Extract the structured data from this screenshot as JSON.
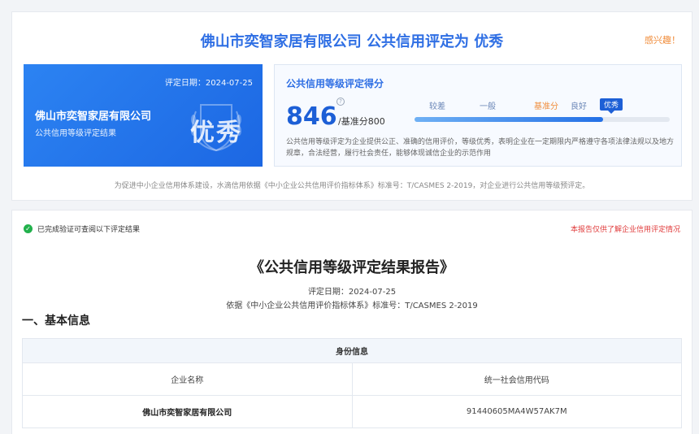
{
  "header": {
    "title": "佛山市奕智家居有限公司 公共信用评定为 优秀",
    "interest_link": "感兴趣！"
  },
  "summary_card": {
    "date": "评定日期：2024-07-25",
    "company": "佛山市奕智家居有限公司",
    "subtitle": "公共信用等级评定结果",
    "badge_text": "优秀",
    "badge_icon": "laurel-shield-icon"
  },
  "score_panel": {
    "title": "公共信用等级评定得分",
    "score": "846",
    "info_icon": "?",
    "baseline": "/基准分800",
    "levels": [
      {
        "label": "较差"
      },
      {
        "label": "一般"
      },
      {
        "label": "基准分"
      },
      {
        "label": "良好"
      },
      {
        "label": "优秀"
      }
    ],
    "progress_fraction": 0.74,
    "description": "公共信用等级评定为企业提供公正、准确的信用评价，等级优秀，表明企业在一定期限内严格遵守各项法律法规以及地方规章，合法经营，履行社会责任，能够体现诚信企业的示范作用"
  },
  "footnote": "为促进中小企业信用体系建设，水滴信用依据《中小企业公共信用评价指标体系》标准号：T/CASMES 2-2019，对企业进行公共信用等级预评定。",
  "report": {
    "verify_text": "已完成验证可查阅以下评定结果",
    "disclaimer": "本报告仅供了解企业信用评定情况",
    "title": "《公共信用等级评定结果报告》",
    "date": "评定日期：2024-07-25",
    "basis": "依据《中小企业公共信用评价指标体系》标准号：T/CASMES 2-2019",
    "section_title": "一、基本信息",
    "table": {
      "caption": "身份信息",
      "columns": [
        "企业名称",
        "统一社会信用代码"
      ],
      "rows": [
        [
          "佛山市奕智家居有限公司",
          "91440605MA4W57AK7M"
        ]
      ]
    }
  },
  "colors": {
    "accent": "#2f6fe4",
    "warning": "#f08c3a",
    "danger": "#e03c3c",
    "success": "#22b14c"
  }
}
